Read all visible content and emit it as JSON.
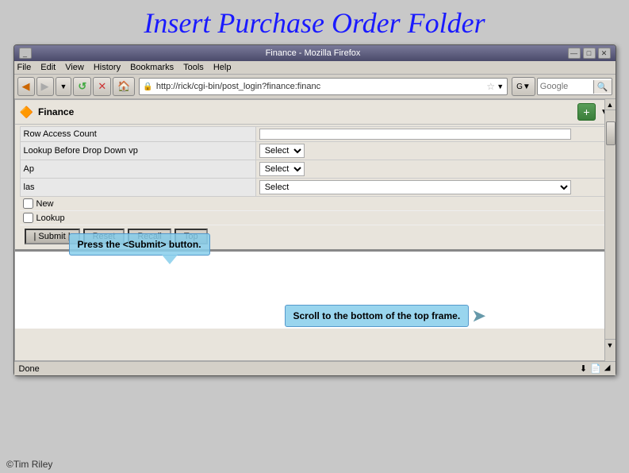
{
  "page": {
    "title": "Insert Purchase Order Folder",
    "copyright": "©Tim Riley"
  },
  "browser": {
    "title_bar": "Finance - Mozilla Firefox",
    "window_controls": [
      "_",
      "□",
      "×"
    ],
    "menu_items": [
      "File",
      "Edit",
      "View",
      "History",
      "Bookmarks",
      "Tools",
      "Help"
    ],
    "address": "http://rick/cgi-bin/post_login?finance:financ",
    "search_placeholder": "Google"
  },
  "finance": {
    "title": "Finance",
    "add_icon": "+",
    "form": {
      "rows": [
        {
          "label": "Row Access Count",
          "input_type": "text",
          "value": ""
        },
        {
          "label": "Lookup Before Drop Down vp",
          "input_type": "select",
          "options": [
            "Select"
          ]
        },
        {
          "label": "Ap",
          "input_type": "select",
          "options": [
            "Select"
          ]
        },
        {
          "label": "las",
          "input_type": "select",
          "options": [
            "Select"
          ]
        }
      ],
      "checkboxes": [
        {
          "id": "new",
          "label": "New"
        },
        {
          "id": "lookup",
          "label": "Lookup"
        }
      ],
      "buttons": [
        "Submit",
        "Reset",
        "Recall",
        "Top"
      ]
    }
  },
  "callouts": {
    "submit": {
      "text": "Press the <Submit> button.",
      "position": "form"
    },
    "scroll": {
      "text": "Scroll to the bottom of the top frame.",
      "position": "bottom"
    }
  },
  "status": {
    "text": "Done"
  }
}
